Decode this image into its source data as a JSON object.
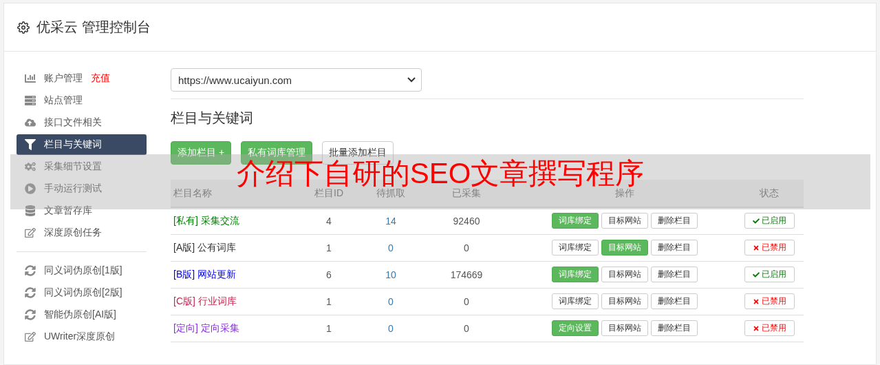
{
  "header": {
    "title": "优采云 管理控制台"
  },
  "sidebar": {
    "groups": [
      {
        "items": [
          {
            "label": "账户管理",
            "badge": "充值",
            "selected": false
          },
          {
            "label": "站点管理",
            "selected": false
          },
          {
            "label": "接口文件相关",
            "selected": false
          },
          {
            "label": "栏目与关键词",
            "selected": true
          },
          {
            "label": "采集细节设置",
            "selected": false
          },
          {
            "label": "手动运行测试",
            "selected": false
          },
          {
            "label": "文章暂存库",
            "selected": false
          },
          {
            "label": "深度原创任务",
            "selected": false
          }
        ]
      },
      {
        "items": [
          {
            "label": "同义词伪原创[1版]",
            "selected": false
          },
          {
            "label": "同义词伪原创[2版]",
            "selected": false
          },
          {
            "label": "智能伪原创[AI版]",
            "selected": false
          },
          {
            "label": "UWriter深度原创",
            "selected": false
          }
        ]
      }
    ]
  },
  "site_select": {
    "value": "https://www.ucaiyun.com"
  },
  "section_title": "栏目与关键词",
  "toolbar": [
    {
      "label": "添加栏目 +",
      "kind": "primary"
    },
    {
      "label": "私有词库管理",
      "kind": "primary"
    },
    {
      "label": "批量添加栏目",
      "kind": "default"
    }
  ],
  "table": {
    "columns": [
      "栏目名称",
      "栏目ID",
      "待抓取",
      "已采集",
      "操作",
      "状态"
    ],
    "rows": [
      {
        "tag": "[私有]",
        "name": "采集交流",
        "color": "#008000",
        "id": "4",
        "pending": "14",
        "collected": "92460",
        "actions": [
          {
            "label": "词库绑定",
            "active": true
          },
          {
            "label": "目标网站",
            "active": false
          },
          {
            "label": "删除栏目",
            "active": false
          }
        ],
        "enabled": true,
        "status": "已启用"
      },
      {
        "tag": "[A版]",
        "name": "公有词库",
        "color": "#333333",
        "id": "1",
        "pending": "0",
        "collected": "0",
        "actions": [
          {
            "label": "词库绑定",
            "active": false
          },
          {
            "label": "目标网站",
            "active": true
          },
          {
            "label": "删除栏目",
            "active": false
          }
        ],
        "enabled": false,
        "status": "已禁用"
      },
      {
        "tag": "[B版]",
        "name": "网站更新",
        "color": "#0000ee",
        "id": "6",
        "pending": "10",
        "collected": "174669",
        "actions": [
          {
            "label": "词库绑定",
            "active": true
          },
          {
            "label": "目标网站",
            "active": false
          },
          {
            "label": "删除栏目",
            "active": false
          }
        ],
        "enabled": true,
        "status": "已启用"
      },
      {
        "tag": "[C版]",
        "name": "行业词库",
        "color": "#c7254e",
        "id": "1",
        "pending": "0",
        "collected": "0",
        "actions": [
          {
            "label": "词库绑定",
            "active": false
          },
          {
            "label": "目标网站",
            "active": false
          },
          {
            "label": "删除栏目",
            "active": false
          }
        ],
        "enabled": false,
        "status": "已禁用"
      },
      {
        "tag": "[定向]",
        "name": "定向采集",
        "color": "#8a2be2",
        "id": "1",
        "pending": "0",
        "collected": "0",
        "actions": [
          {
            "label": "定向设置",
            "active": true
          },
          {
            "label": "目标网站",
            "active": false
          },
          {
            "label": "删除栏目",
            "active": false
          }
        ],
        "enabled": false,
        "status": "已禁用"
      }
    ]
  },
  "overlay_banner": "介绍下自研的SEO文章撰写程序"
}
